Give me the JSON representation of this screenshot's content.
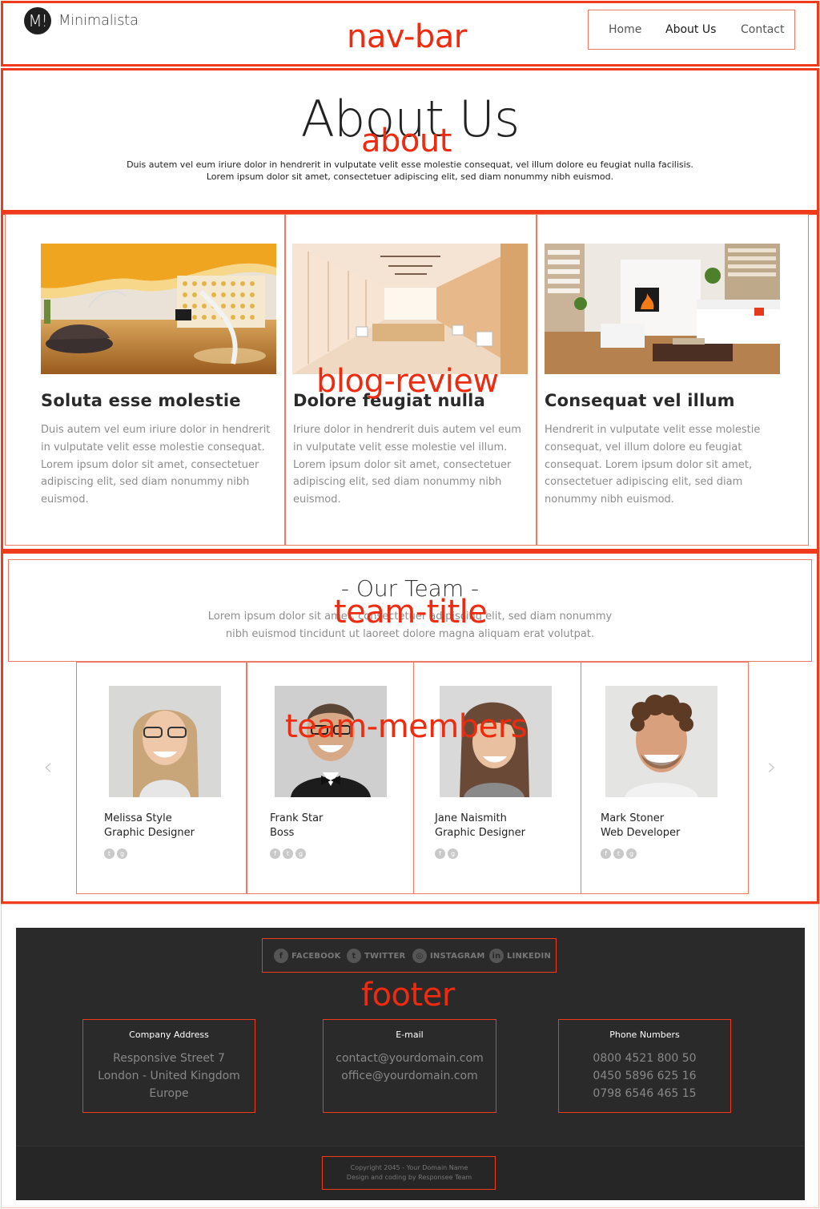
{
  "nav": {
    "logo_mark": "M!",
    "logo_text": "Minimalista",
    "items": [
      {
        "label": "Home"
      },
      {
        "label": "About Us"
      },
      {
        "label": "Contact"
      }
    ]
  },
  "about": {
    "title": "About Us",
    "line1": "Duis autem vel eum iriure dolor in hendrerit in vulputate velit esse molestie consequat, vel illum dolore eu feugiat nulla facilisis.",
    "line2": "Lorem ipsum dolor sit amet, consectetuer adipiscing elit, sed diam nonummy nibh euismod."
  },
  "blog": [
    {
      "title": "Soluta esse molestie",
      "text": "Duis autem vel eum iriure dolor in hendrerit in vulputate velit esse molestie consequat. Lorem ipsum dolor sit amet, consectetuer adipiscing elit, sed diam nonummy nibh euismod."
    },
    {
      "title": "Dolore feugiat nulla",
      "text": "Iriure dolor in hendrerit duis autem vel eum in vulputate velit esse molestie vel illum. Lorem ipsum dolor sit amet, consectetuer adipiscing elit, sed diam nonummy nibh euismod."
    },
    {
      "title": "Consequat vel illum",
      "text": "Hendrerit in vulputate velit esse molestie consequat, vel illum dolore eu feugiat consequat. Lorem ipsum dolor sit amet, consectetuer adipiscing elit, sed diam nonummy nibh euismod."
    }
  ],
  "team": {
    "title": "- Our Team -",
    "line1": "Lorem ipsum dolor sit amet, consectetuer adipiscing elit, sed diam nonummy",
    "line2": "nibh euismod tincidunt ut laoreet dolore magna aliquam erat volutpat.",
    "prev_arrow": "‹",
    "next_arrow": "›",
    "members": [
      {
        "name": "Melissa Style",
        "role": "Graphic Designer",
        "socials": [
          "twitter-icon",
          "google-plus-icon"
        ]
      },
      {
        "name": "Frank Star",
        "role": "Boss",
        "socials": [
          "facebook-icon",
          "twitter-icon",
          "google-plus-icon"
        ]
      },
      {
        "name": "Jane Naismith",
        "role": "Graphic Designer",
        "socials": [
          "facebook-icon",
          "google-plus-icon"
        ]
      },
      {
        "name": "Mark Stoner",
        "role": "Web Developer",
        "socials": [
          "facebook-icon",
          "twitter-icon",
          "google-plus-icon"
        ]
      }
    ]
  },
  "footer": {
    "social": [
      {
        "label": "FACEBOOK",
        "icon": "facebook-icon"
      },
      {
        "label": "TWITTER",
        "icon": "twitter-icon"
      },
      {
        "label": "INSTAGRAM",
        "icon": "instagram-icon"
      },
      {
        "label": "LINKEDIN",
        "icon": "linkedin-icon"
      }
    ],
    "address": {
      "heading": "Company Address",
      "lines": [
        "Responsive Street 7",
        "London - United Kingdom",
        "Europe"
      ]
    },
    "email": {
      "heading": "E-mail",
      "lines": [
        "contact@yourdomain.com",
        "office@yourdomain.com"
      ]
    },
    "phone": {
      "heading": "Phone Numbers",
      "lines": [
        "0800 4521 800 50",
        "0450 5896 625 16",
        "0798 6546 465 15"
      ]
    },
    "copyright_line1": "Copyright 2045 - Your Domain Name",
    "copyright_line2": "Design and coding by Responsee Team"
  },
  "annotations": {
    "nav": "nav-bar",
    "about": "about",
    "blog": "blog-review",
    "team_title": "team-title",
    "team_members": "team-members",
    "footer": "footer"
  },
  "colors": {
    "annotation_red": "#ef3a1c",
    "footer_bg": "#2a2a2a"
  }
}
